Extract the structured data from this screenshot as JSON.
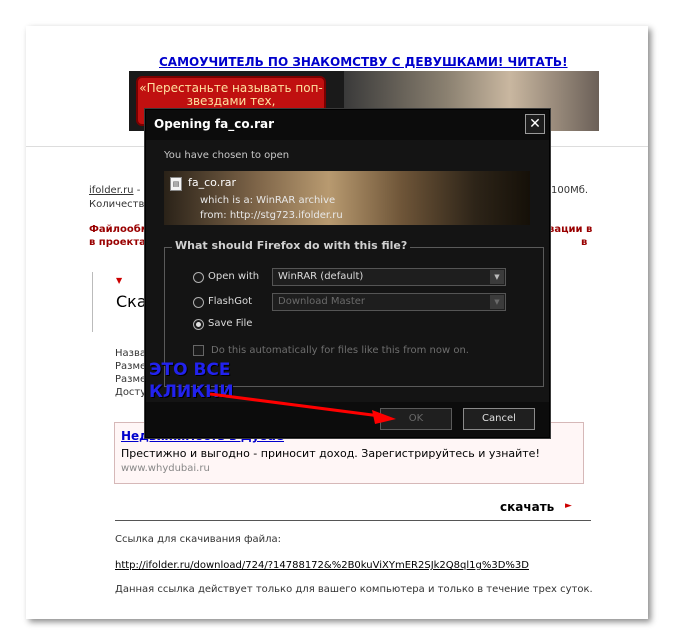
{
  "background_page": {
    "promo_link": "САМОУЧИТЕЛЬ ПО ЗНАКОМСТВУ С ДЕВУШКАМИ!   ЧИТАТЬ!",
    "banner_text": "«Перестаньте называть поп-звездами тех,",
    "site_link": "ifolder.ru",
    "site_text_1": " - ",
    "site_text_right": "100Мб.",
    "quantity_label": "Количеств",
    "red_text_left": "Файлообм",
    "red_text_left_2": "в проектах",
    "red_text_right": "вации в",
    "red_text_right_2": "в",
    "heading": "Ска",
    "info_labels": [
      "Назва",
      "Разме",
      "Разме",
      "Досту"
    ],
    "ad_title": "Недвижимость в Дубае",
    "ad_desc": "Престижно и выгодно - приносит доход. Зарегистрируйтесь и узнайте!",
    "ad_url": "www.whydubai.ru",
    "download_label": "скачать",
    "download_note": "Ссылка для скачивания файла:",
    "download_url": "http://ifolder.ru/download/724/?14788172&%2B0kuViXYmER2SJk2Q8ql1g%3D%3D",
    "validity_note": "Данная ссылка действует только для вашего компьютера и только в течение трех суток."
  },
  "dialog": {
    "title": "Opening fa_co.rar",
    "close_label": "✕",
    "chosen_text": "You have chosen to open",
    "file_name": "fa_co.rar",
    "which_is": "which is a:  WinRAR archive",
    "from": "from:  http://stg723.ifolder.ru",
    "group_legend": "What should Firefox do with this file?",
    "options": [
      {
        "label": "Open with",
        "selected": false,
        "app": "WinRAR (default)"
      },
      {
        "label": "FlashGot",
        "selected": false,
        "app": "Download Master"
      },
      {
        "label": "Save File",
        "selected": true
      }
    ],
    "auto_checkbox_label": "Do this automatically for files like this from now on.",
    "ok_label": "OK",
    "cancel_label": "Cancel"
  },
  "annotation": {
    "line1": "ЭТО ВСЕ",
    "line2": "КЛИКНИ",
    "color": "#2222ee",
    "arrow_color": "#ff0000"
  }
}
